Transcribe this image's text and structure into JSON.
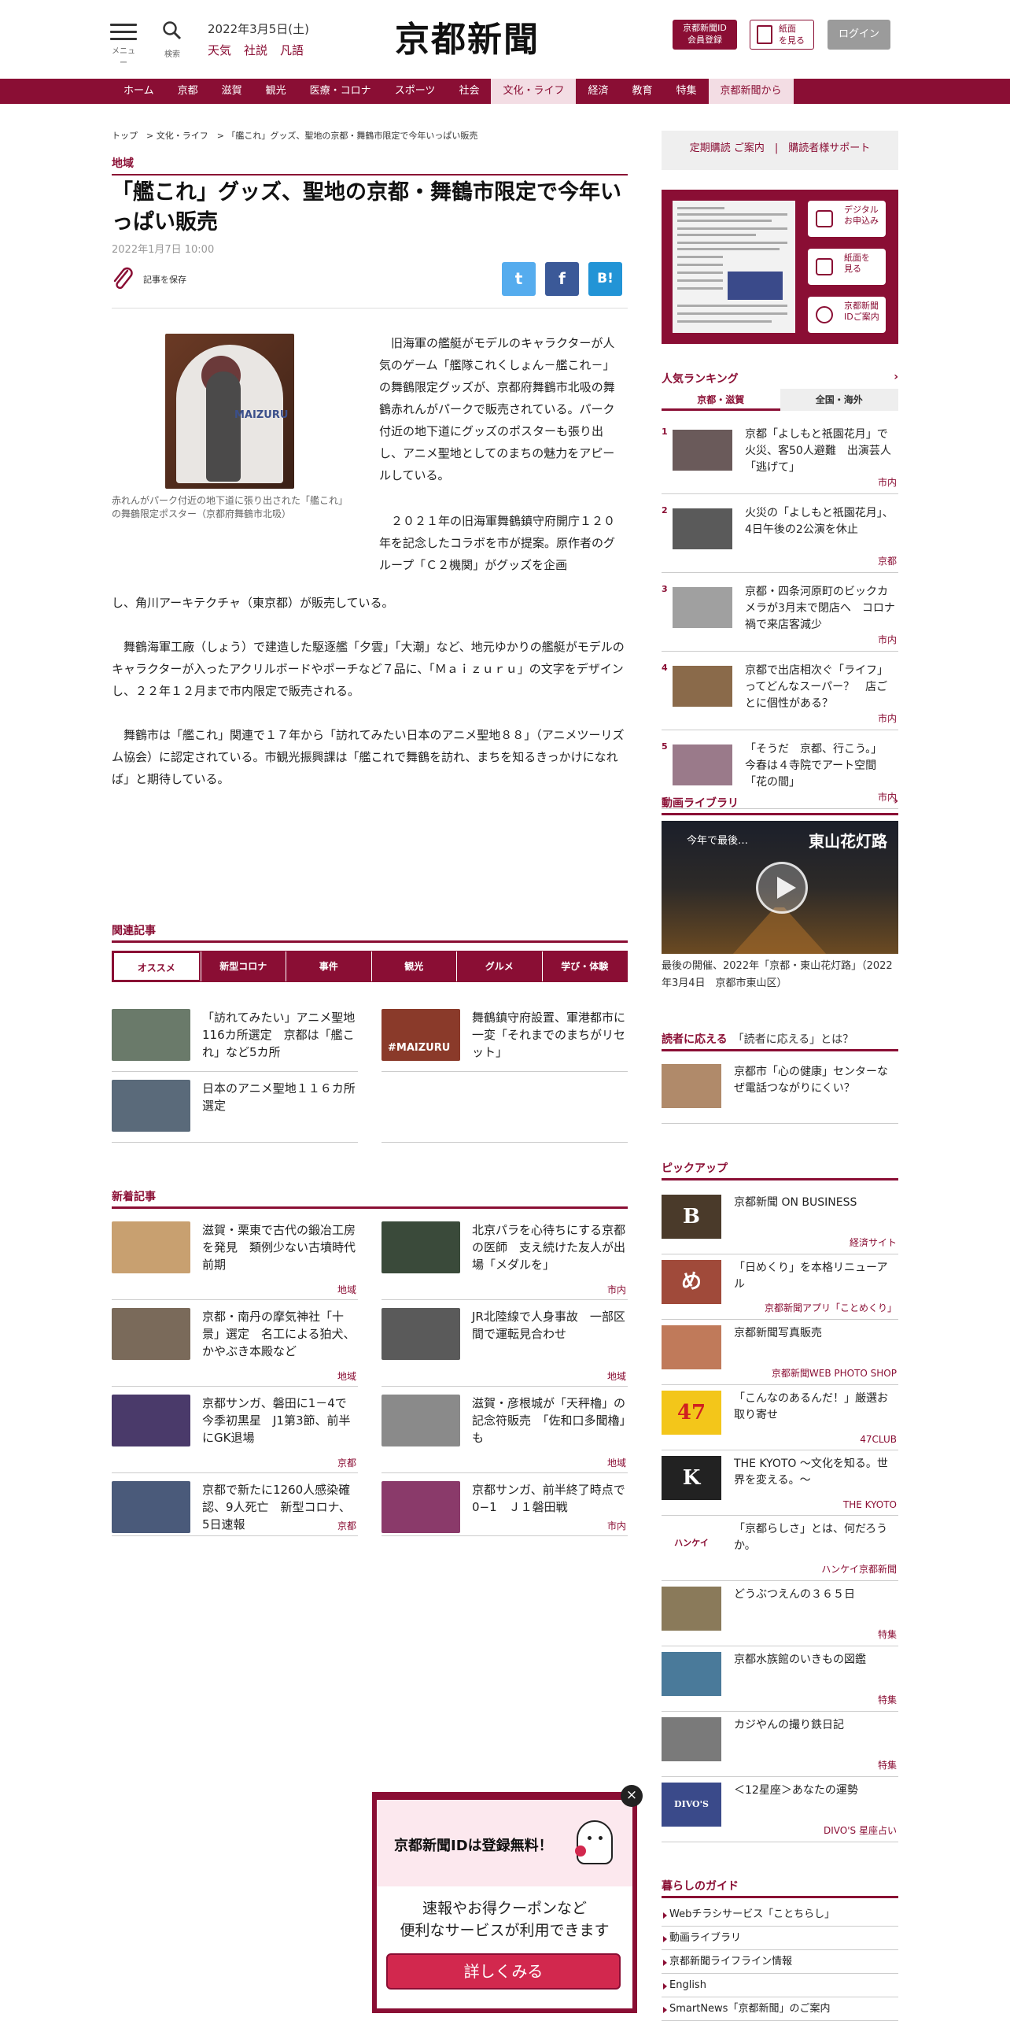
{
  "header": {
    "menu_label": "メニュー",
    "search_label": "検索",
    "date": "2022年3月5日(土)",
    "links": [
      "天気",
      "社説",
      "凡語"
    ],
    "logo": "京都新聞",
    "member_btn": [
      "京都新聞ID",
      "会員登録"
    ],
    "paper_btn": [
      "紙面",
      "を見る"
    ],
    "login_btn": "ログイン"
  },
  "nav": [
    "ホーム",
    "京都",
    "滋賀",
    "観光",
    "医療・コロナ",
    "スポーツ",
    "社会",
    "文化・ライフ",
    "経済",
    "教育",
    "特集",
    "京都新聞から"
  ],
  "article": {
    "breadcrumb": "トップ　> 文化・ライフ　> 「艦これ」グッズ、聖地の京都・舞鶴市限定で今年いっぱい販売",
    "category": "地域",
    "title": "「艦これ」グッズ、聖地の京都・舞鶴市限定で今年いっぱい販売",
    "date": "2022年1月7日 10:00",
    "save_label": "記事を保存",
    "share": [
      "t",
      "f",
      "B!"
    ],
    "caption": "赤れんがパーク付近の地下道に張り出された「艦これ」の舞鶴限定ポスター（京都府舞鶴市北吸）",
    "photo_text": "MAIZURU",
    "p1": "　旧海軍の艦艇がモデルのキャラクターが人気のゲーム「艦隊これくしょん－艦これ－」の舞鶴限定グッズが、京都府舞鶴市北吸の舞鶴赤れんがパークで販売されている。パーク付近の地下道にグッズのポスターも張り出し、アニメ聖地としてのまちの魅力をアピールしている。",
    "p2": "　２０２１年の旧海軍舞鶴鎮守府開庁１２０年を記念したコラボを市が提案。原作者のグループ「Ｃ２機関」がグッズを企画し、角川アーキテクチャ（東京都）が販売している。",
    "p3": "　舞鶴海軍工廠（しょう）で建造した駆逐艦「夕雲」「大潮」など、地元ゆかりの艦艇がモデルのキャラクターが入ったアクリルボードやポーチなど７品に、「Ｍａｉｚｕｒｕ」の文字をデザインし、２２年１２月まで市内限定で販売される。",
    "p4": "　舞鶴市は「艦これ」関連で１７年から「訪れてみたい日本のアニメ聖地８８」（アニメツーリズム協会）に認定されている。市観光振興課は「艦これで舞鶴を訪れ、まちを知るきっかけになれば」と期待している。"
  },
  "related": {
    "title": "関連記事",
    "tabs": [
      "オススメ",
      "新型コロナ",
      "事件",
      "観光",
      "グルメ",
      "学び・体験"
    ],
    "items": [
      {
        "text": "「訪れてみたい」アニメ聖地116カ所選定　京都は「艦これ」など5カ所",
        "color": "#6a7a6a"
      },
      {
        "text": "舞鶴鎮守府設置、軍港都市に一変「それまでのまちがリセット」",
        "color": "#8a3a2a",
        "badge": "#MAIZURU"
      },
      {
        "text": "日本のアニメ聖地１１６カ所選定",
        "color": "#5a6a7a"
      }
    ]
  },
  "newest": {
    "title": "新着記事",
    "items": [
      {
        "text": "滋賀・栗東で古代の鍛冶工房を発見　類例少ない古墳時代前期",
        "tag": "地域",
        "color": "#c8a070"
      },
      {
        "text": "北京パラを心待ちにする京都の医師　支え続けた友人が出場「メダルを」",
        "tag": "市内",
        "color": "#3a4a3a"
      },
      {
        "text": "京都・南丹の摩気神社「十景」選定　名工による狛犬、かやぶき本殿など",
        "tag": "地域",
        "color": "#7a6a5a"
      },
      {
        "text": "JR北陸線で人身事故　一部区間で運転見合わせ",
        "tag": "地域",
        "color": "#5a5a5a"
      },
      {
        "text": "京都サンガ、磐田に1－4で今季初黒星　J1第3節、前半にGK退場",
        "tag": "京都",
        "color": "#4a3a6a"
      },
      {
        "text": "滋賀・彦根城が「天秤櫓」の記念符販売　「佐和口多聞櫓」も",
        "tag": "地域",
        "color": "#8a8a8a"
      },
      {
        "text": "京都で新たに1260人感染確認、9人死亡　新型コロナ、5日速報",
        "tag": "京都",
        "color": "#4a5a7a"
      },
      {
        "text": "京都サンガ、前半終了時点で0−1　Ｊ１磐田戦",
        "tag": "市内",
        "color": "#8a3a6a"
      }
    ]
  },
  "sidebar": {
    "subscribe": "定期購読 ご案内　|　購読者様サポート",
    "paper_buttons": [
      "デジタル|お申込み",
      "紙面を|見る",
      "京都新聞|IDご案内"
    ],
    "ranking": {
      "title": "人気ランキング",
      "tabs": [
        "京都・滋賀",
        "全国・海外"
      ],
      "items": [
        {
          "n": "1",
          "text": "京都「よしもと祇園花月」で火災、客50人避難　出演芸人「逃げて」",
          "tag": "市内",
          "color": "#6a5a5a"
        },
        {
          "n": "2",
          "text": "火災の「よしもと祇園花月」、4日午後の2公演を休止",
          "tag": "京都",
          "color": "#5a5a5a"
        },
        {
          "n": "3",
          "text": "京都・四条河原町のビックカメラが3月末で閉店へ　コロナ禍で来店客減少",
          "tag": "市内",
          "color": "#a0a0a0"
        },
        {
          "n": "4",
          "text": "京都で出店相次ぐ「ライフ」ってどんなスーパー？　店ごとに個性がある？",
          "tag": "市内",
          "color": "#8a6a4a"
        },
        {
          "n": "5",
          "text": "「そうだ　京都、行こう。」　今春は４寺院でアート空間「花の間」",
          "tag": "市内",
          "color": "#9a7a8a"
        }
      ]
    },
    "video": {
      "title": "動画ライブラリ",
      "overlay_left": "今年で最後…",
      "overlay_right": "東山花灯路",
      "caption": "最後の開催、2022年「京都・東山花灯路」（2022年3月4日　京都市東山区）"
    },
    "reader": {
      "title": "読者に応える",
      "title2": "「読者に応える」とは？",
      "text": "京都市「心の健康」センターなぜ電話つながりにくい？"
    },
    "pickup": {
      "title": "ピックアップ",
      "items": [
        {
          "text": "京都新聞 ON BUSINESS",
          "tag": "経済サイト",
          "mark": "B",
          "bg": "#4a3a2a"
        },
        {
          "text": "「日めくり」を本格リニューアル",
          "tag": "京都新聞アプリ「ことめくり」",
          "mark": "め",
          "bg": "#a04a3a"
        },
        {
          "text": "京都新聞写真販売",
          "tag": "京都新聞WEB PHOTO SHOP",
          "mark": "",
          "bg": "#c07a5a"
        },
        {
          "text": "「こんなのあるんだ！」厳選お取り寄せ",
          "tag": "47CLUB",
          "mark": "47",
          "bg": "#f3c61a"
        },
        {
          "text": "THE KYOTO ～文化を知る。世界を変える。～",
          "tag": "THE KYOTO",
          "mark": "K",
          "bg": "#222222"
        },
        {
          "text": "「京都らしさ」とは、何だろうか。",
          "tag": "ハンケイ京都新聞",
          "mark": "ハンケイ",
          "bg": "#ffffff"
        },
        {
          "text": "どうぶつえんの３６５日",
          "tag": "特集",
          "mark": "",
          "bg": "#8a7a5a"
        },
        {
          "text": "京都水族館のいきもの図鑑",
          "tag": "特集",
          "mark": "",
          "bg": "#4a7a9a"
        },
        {
          "text": "カジやんの撮り鉄日記",
          "tag": "特集",
          "mark": "",
          "bg": "#7a7a7a"
        },
        {
          "text": "＜12星座＞あなたの運勢",
          "tag": "DIVO'S 星座占い",
          "mark": "DIVO'S",
          "bg": "#3a4a8a"
        }
      ]
    },
    "guide": {
      "title": "暮らしのガイド",
      "items": [
        "Webチラシサービス「ことちらし」",
        "動画ライブラリ",
        "京都新聞ライフライン情報",
        "English",
        "SmartNews「京都新聞」のご案内"
      ]
    }
  },
  "popup": {
    "heading": "京都新聞IDは登録無料！",
    "line1": "速報やお得クーポンなど",
    "line2": "便利なサービスが利用できます",
    "button": "詳しくみる",
    "close": "×"
  }
}
